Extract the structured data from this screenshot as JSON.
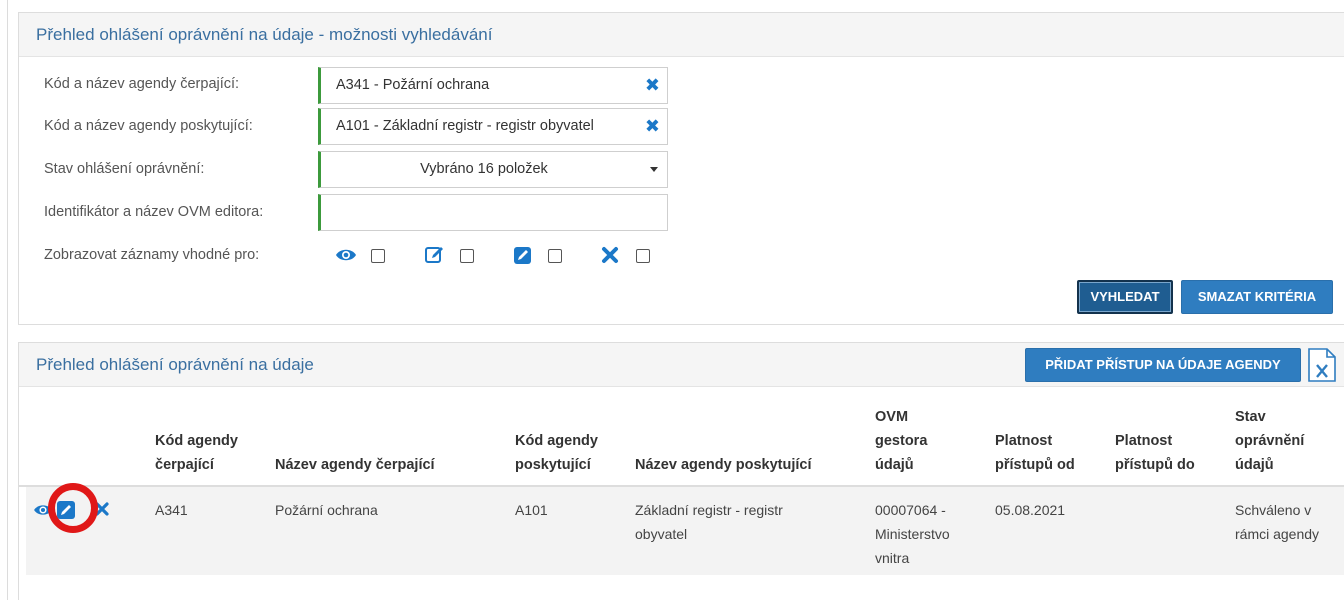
{
  "search": {
    "title": "Přehled ohlášení oprávnění na údaje - možnosti vyhledávání",
    "fields": [
      {
        "label": "Kód a název agendy čerpající:",
        "value": "A341 - Požární ochrana"
      },
      {
        "label": "Kód a název agendy poskytující:",
        "value": "A101 - Základní registr - registr obyvatel"
      },
      {
        "label": "Stav ohlášení oprávnění:",
        "value": "Vybráno 16 položek"
      },
      {
        "label": "Identifikátor a název OVM editora:",
        "value": ""
      },
      {
        "label": "Zobrazovat záznamy vhodné pro:",
        "value": ""
      }
    ],
    "options": [
      {
        "icon": "eye-icon",
        "checked": false
      },
      {
        "icon": "edit-outline-icon",
        "checked": false
      },
      {
        "icon": "edit-filled-icon",
        "checked": false
      },
      {
        "icon": "close-icon",
        "checked": false
      }
    ],
    "search_button": "VYHLEDAT",
    "clear_button": "SMAZAT KRITÉRIA",
    "accent_color": "#2f7dc0",
    "field_border_color": "#3c9a3c"
  },
  "results": {
    "title": "Přehled ohlášení oprávnění na údaje",
    "add_button": "PŘIDAT PŘÍSTUP NA ÚDAJE AGENDY",
    "export_icon": "excel-export-icon",
    "columns": [
      [
        "Kód agendy",
        "čerpající"
      ],
      [
        "Název agendy čerpající"
      ],
      [
        "Kód agendy",
        "poskytující"
      ],
      [
        "Název agendy poskytující"
      ],
      [
        "OVM",
        "gestora",
        "údajů"
      ],
      [
        "Platnost",
        "přístupů od"
      ],
      [
        "Platnost",
        "přístupů do"
      ],
      [
        "Stav",
        "oprávnění",
        "údajů"
      ]
    ],
    "rows": [
      {
        "actions": [
          "eye-icon",
          "edit-icon",
          "close-icon"
        ],
        "cells": [
          [
            "A341"
          ],
          [
            "Požární ochrana"
          ],
          [
            "A101"
          ],
          [
            "Základní registr - registr",
            "obyvatel"
          ],
          [
            "00007064 -",
            "Ministerstvo",
            "vnitra"
          ],
          [
            "05.08.2021"
          ],
          [],
          [
            "Schváleno v",
            "rámci agendy"
          ]
        ]
      }
    ],
    "highlight_color": "#e01818"
  }
}
